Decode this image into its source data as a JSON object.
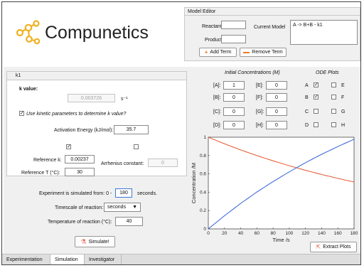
{
  "app": {
    "name": "Compunetics",
    "logo_color": "#f0b020"
  },
  "model_editor": {
    "title": "Model Editor",
    "reactants_label": "Reactants:",
    "products_label": "Products:",
    "reactants_value": "",
    "products_value": "",
    "current_model_label": "Current Model",
    "current_model_text": "A -> B+B  - k1",
    "add_term": "Add Term",
    "remove_term": "Remove Term"
  },
  "k_panel": {
    "tab": "k1",
    "k_value_label": "k value:",
    "k_value": "0.003726",
    "k_unit": "s⁻¹",
    "use_kinetic_label": "Use kinetic parameters to determine k value?",
    "use_kinetic_checked": true,
    "activation_energy_label": "Activation Energy (kJ/mol):",
    "activation_energy": "35.7",
    "ref_k_label": "Reference k:",
    "ref_k": "0.00237",
    "ref_t_label": "Reference T (°C):",
    "ref_t": "30",
    "arrhenius_label": "Arrhenius constant:",
    "arrhenius_value": "0",
    "left_checked": true,
    "right_checked": false
  },
  "simulation": {
    "sim_from_label": "Experiment is simulated from: 0 -",
    "sim_to": "180",
    "seconds_label": "seconds.",
    "timescale_label": "Timescale of reaction:",
    "timescale_value": "seconds",
    "temperature_label": "Temperature of reaction (°C):",
    "temperature": "40",
    "simulate_button": "Simulate!"
  },
  "concentrations": {
    "heading": "Initial Concentrations (M)",
    "left": [
      {
        "label": "[A]:",
        "value": "1"
      },
      {
        "label": "[B]:",
        "value": "0"
      },
      {
        "label": "[C]:",
        "value": "0"
      },
      {
        "label": "[D]:",
        "value": "0"
      }
    ],
    "right": [
      {
        "label": "[E]:",
        "value": "0"
      },
      {
        "label": "[F]:",
        "value": "0"
      },
      {
        "label": "[G]:",
        "value": "0"
      },
      {
        "label": "[H]:",
        "value": "0"
      }
    ]
  },
  "ode_plots": {
    "heading": "ODE Plots",
    "left": [
      {
        "label": "A",
        "checked": true
      },
      {
        "label": "B",
        "checked": true
      },
      {
        "label": "C",
        "checked": false
      },
      {
        "label": "D",
        "checked": false
      }
    ],
    "right": [
      {
        "label": "E",
        "checked": false
      },
      {
        "label": "F",
        "checked": false
      },
      {
        "label": "G",
        "checked": false
      },
      {
        "label": "H",
        "checked": false
      }
    ]
  },
  "extract_plots": "Extract Plots",
  "tabs": [
    "Experimentation",
    "Simulation",
    "Investigator"
  ],
  "active_tab": "Simulation",
  "chart_data": {
    "type": "line",
    "xlabel": "Time /s",
    "ylabel": "Concentration /M",
    "xlim": [
      0,
      180
    ],
    "ylim": [
      0,
      1
    ],
    "xticks": [
      0,
      20,
      40,
      60,
      80,
      100,
      120,
      140,
      160,
      180
    ],
    "yticks": [
      0,
      0.2,
      0.4,
      0.6,
      0.8,
      1
    ],
    "xtick_labels": [
      "0",
      "20",
      "40",
      "60",
      "80",
      "100",
      "120",
      "140",
      "160",
      "180"
    ],
    "ytick_labels": [
      "0",
      "0.2",
      "0.4",
      "0.6",
      "0.8",
      "1"
    ],
    "grid": false,
    "series": [
      {
        "color": "#e8502a",
        "x": [
          0,
          20,
          40,
          60,
          80,
          100,
          120,
          140,
          160,
          180
        ],
        "values": [
          1,
          0.928,
          0.861,
          0.799,
          0.742,
          0.689,
          0.639,
          0.593,
          0.551,
          0.511
        ]
      },
      {
        "color": "#2f5fd8",
        "x": [
          0,
          20,
          40,
          60,
          80,
          100,
          120,
          140,
          160,
          180
        ],
        "values": [
          0,
          0.144,
          0.278,
          0.402,
          0.516,
          0.622,
          0.722,
          0.814,
          0.898,
          0.978
        ]
      }
    ]
  }
}
